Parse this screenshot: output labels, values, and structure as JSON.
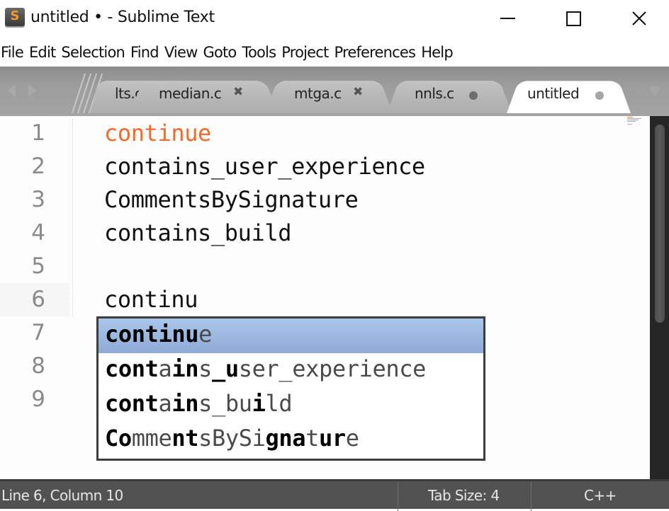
{
  "window": {
    "title": "untitled • - Sublime Text",
    "app_icon_letter": "S",
    "controls": {
      "minimize": "minimize-icon",
      "maximize": "maximize-icon",
      "close": "close-icon"
    }
  },
  "menu": [
    "File",
    "Edit",
    "Selection",
    "Find",
    "View",
    "Goto",
    "Tools",
    "Project",
    "Preferences",
    "Help"
  ],
  "tabs": [
    {
      "label": "lts.c",
      "state": "overflowed"
    },
    {
      "label": "median.c",
      "indicator": "close",
      "glyph": "✖"
    },
    {
      "label": "mtga.c",
      "indicator": "close",
      "glyph": "✖"
    },
    {
      "label": "nnls.c",
      "indicator": "modified-dot"
    },
    {
      "label": "untitled",
      "indicator": "modified-dot",
      "active": true
    }
  ],
  "editor": {
    "lines": [
      {
        "num": "1",
        "text": "continue",
        "keyword": true
      },
      {
        "num": "2",
        "text": "contains_user_experience"
      },
      {
        "num": "3",
        "text": "CommentsBySignature"
      },
      {
        "num": "4",
        "text": "contains_build"
      },
      {
        "num": "5",
        "text": ""
      },
      {
        "num": "6",
        "text": "continu"
      },
      {
        "num": "7",
        "text": ""
      },
      {
        "num": "8",
        "text": ""
      },
      {
        "num": "9",
        "text": ""
      }
    ],
    "keyword_color": "#f5692b"
  },
  "autocomplete": {
    "items": [
      {
        "text": "continue",
        "matched_mask": "11111110",
        "selected": true
      },
      {
        "text": "contains_user_experience",
        "matched_mask": "111101101100000000000000"
      },
      {
        "text": "contains_build",
        "matched_mask": "11110110000100"
      },
      {
        "text": "CommentsBySignature",
        "matched_mask": "1100011000001110110"
      }
    ],
    "selected_color": "#9db8e1"
  },
  "status": {
    "position": "Line 6, Column 10",
    "tab_size": "Tab Size: 4",
    "syntax": "C++"
  }
}
